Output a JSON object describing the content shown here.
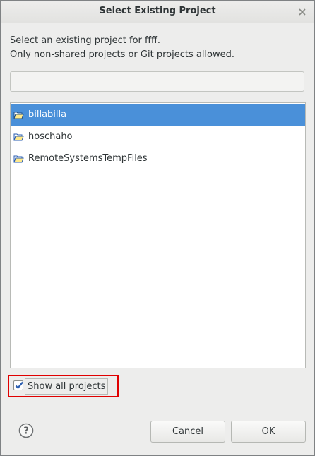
{
  "window": {
    "title": "Select Existing Project"
  },
  "description": {
    "line1": "Select an existing project for ffff.",
    "line2": "Only non-shared projects or Git projects allowed."
  },
  "filter": {
    "value": "",
    "placeholder": ""
  },
  "projects": [
    {
      "label": "billabilla",
      "selected": true,
      "icon": "folder-icon"
    },
    {
      "label": "hoschaho",
      "selected": false,
      "icon": "folder-icon"
    },
    {
      "label": "RemoteSystemsTempFiles",
      "selected": false,
      "icon": "folder-icon"
    }
  ],
  "show_all": {
    "label": "Show all projects",
    "checked": true
  },
  "buttons": {
    "cancel": "Cancel",
    "ok": "OK"
  },
  "colors": {
    "selection": "#4a90d9",
    "highlight": "#e00000"
  }
}
